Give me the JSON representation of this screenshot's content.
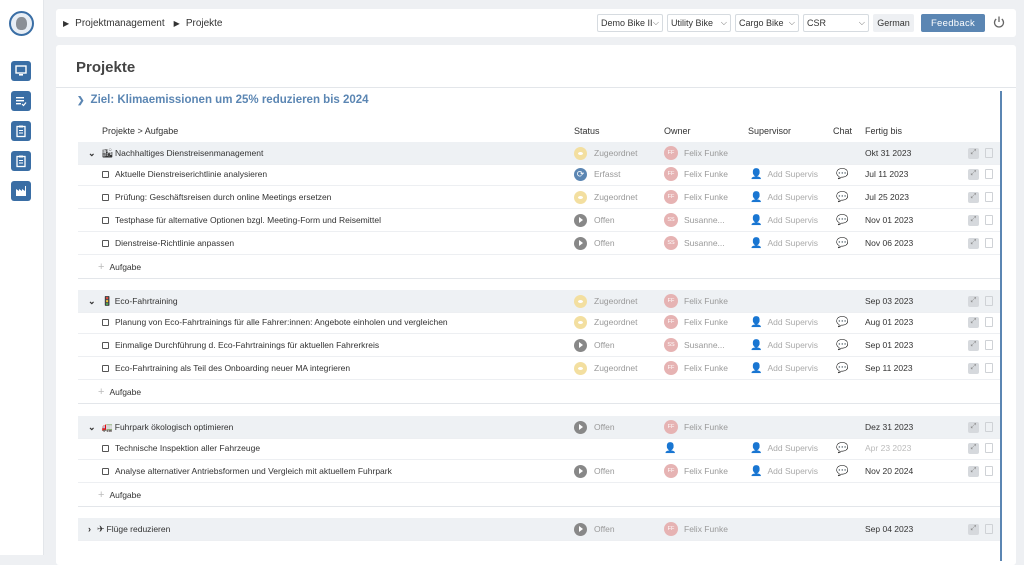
{
  "breadcrumb": {
    "items": [
      "Projektmanagement",
      "Projekte"
    ]
  },
  "topbar": {
    "selects": [
      {
        "value": "Demo Bike II"
      },
      {
        "value": "Utility Bike"
      },
      {
        "value": "Cargo Bike"
      },
      {
        "value": "CSR"
      }
    ],
    "language": "German",
    "feedback": "Feedback"
  },
  "page": {
    "title": "Projekte"
  },
  "goal": {
    "label": "Ziel: Klimaemissionen um 25% reduzieren bis 2024"
  },
  "columns": {
    "project": "Projekte > Aufgabe",
    "status": "Status",
    "owner": "Owner",
    "supervisor": "Supervisor",
    "chat": "Chat",
    "due": "Fertig bis"
  },
  "add_task_label": "Aufgabe",
  "groups": [
    {
      "name": "Nachhaltiges Dienstreisenmanagement",
      "icon": "🏙",
      "status": "Zugeordnet",
      "owner_initials": "FF",
      "owner": "Felix Funke",
      "due": "Okt 31 2023",
      "tasks": [
        {
          "name": "Aktuelle Dienstreiserichtlinie analysieren",
          "status": "Erfasst",
          "owner_initials": "FF",
          "owner": "Felix Funke",
          "supervisor": "Add Supervis",
          "due": "Jul 11 2023"
        },
        {
          "name": "Prüfung: Geschäftsreisen durch online Meetings ersetzen",
          "status": "Zugeordnet",
          "owner_initials": "FF",
          "owner": "Felix Funke",
          "supervisor": "Add Supervis",
          "due": "Jul 25 2023"
        },
        {
          "name": "Testphase für alternative Optionen bzgl. Meeting-Form und Reisemittel",
          "status": "Offen",
          "owner_initials": "SS",
          "owner": "Susanne...",
          "supervisor": "Add Supervis",
          "due": "Nov 01 2023"
        },
        {
          "name": "Dienstreise-Richtlinie anpassen",
          "status": "Offen",
          "owner_initials": "SS",
          "owner": "Susanne...",
          "supervisor": "Add Supervis",
          "due": "Nov 06 2023"
        }
      ]
    },
    {
      "name": "Eco-Fahrtraining",
      "icon": "🚦",
      "status": "Zugeordnet",
      "owner_initials": "FF",
      "owner": "Felix Funke",
      "due": "Sep 03 2023",
      "tasks": [
        {
          "name": "Planung von Eco-Fahrtrainings für alle Fahrer:innen: Angebote einholen und vergleichen",
          "status": "Zugeordnet",
          "owner_initials": "FF",
          "owner": "Felix Funke",
          "supervisor": "Add Supervis",
          "due": "Aug 01 2023"
        },
        {
          "name": "Einmalige Durchführung d. Eco-Fahrtrainings für aktuellen Fahrerkreis",
          "status": "Offen",
          "owner_initials": "SS",
          "owner": "Susanne...",
          "supervisor": "Add Supervis",
          "due": "Sep 01 2023"
        },
        {
          "name": "Eco-Fahrtraining als Teil des Onboarding neuer MA integrieren",
          "status": "Zugeordnet",
          "owner_initials": "FF",
          "owner": "Felix Funke",
          "supervisor": "Add Supervis",
          "due": "Sep 11 2023"
        }
      ]
    },
    {
      "name": "Fuhrpark ökologisch optimieren",
      "icon": "🚛",
      "status": "Offen",
      "owner_initials": "FF",
      "owner": "Felix Funke",
      "due": "Dez 31 2023",
      "tasks": [
        {
          "name": "Technische Inspektion aller Fahrzeuge",
          "status": "",
          "owner_initials": "",
          "owner": "",
          "supervisor": "Add Supervis",
          "due": "Apr 23 2023"
        },
        {
          "name": "Analyse alternativer Antriebsformen und Vergleich mit aktuellem Fuhrpark",
          "status": "Offen",
          "owner_initials": "FF",
          "owner": "Felix Funke",
          "supervisor": "Add Supervis",
          "due": "Nov 20 2024"
        }
      ]
    },
    {
      "name": "Flüge reduzieren",
      "icon": "✈",
      "status": "Offen",
      "owner_initials": "FF",
      "owner": "Felix Funke",
      "due": "Sep 04 2023",
      "tasks": []
    }
  ]
}
